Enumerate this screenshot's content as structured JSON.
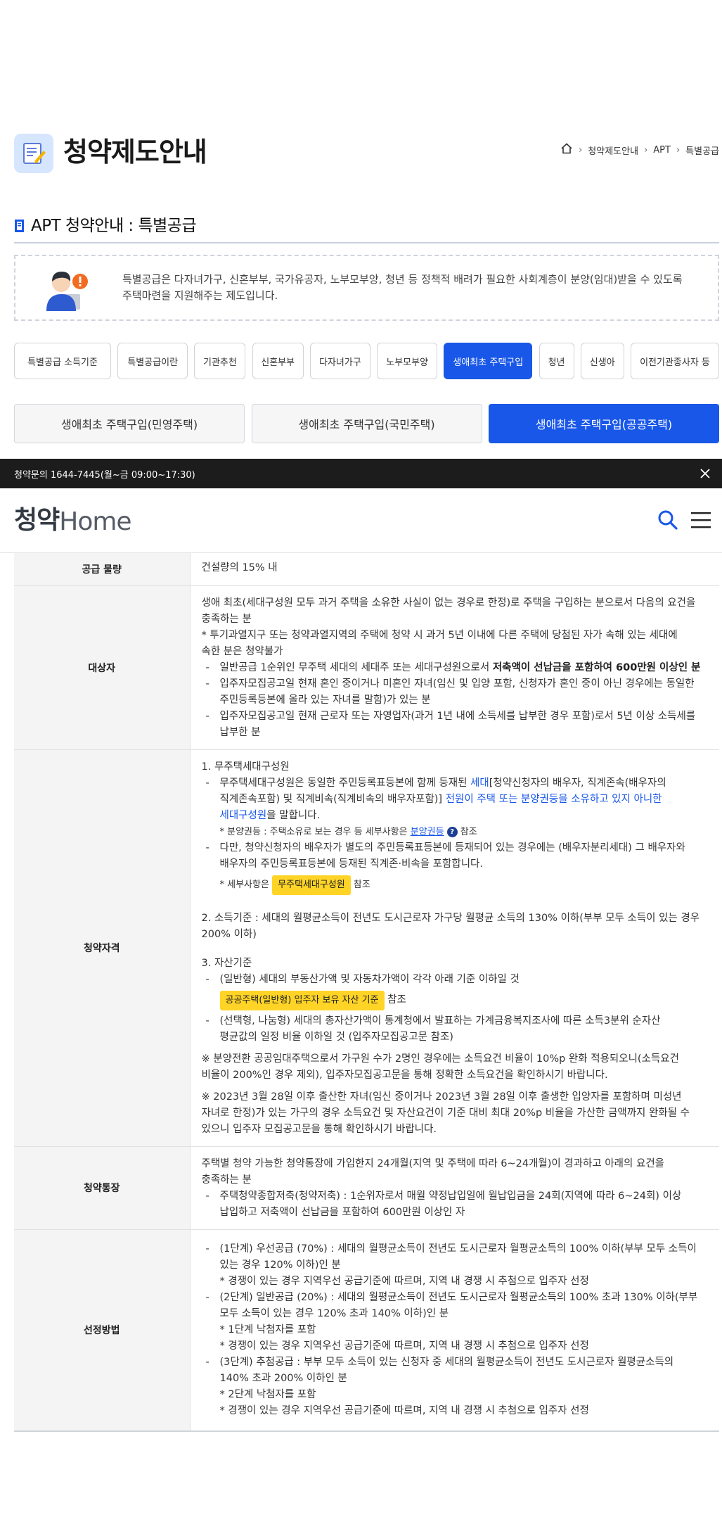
{
  "header": {
    "title": "청약제도안내",
    "breadcrumb": [
      "청약제도안내",
      "APT",
      "특별공급"
    ]
  },
  "section": {
    "title": "APT 청약안내 : 특별공급"
  },
  "notice": {
    "line1": "특별공급은 다자녀가구, 신혼부부, 국가유공자, 노부모부양, 청년 등 정책적 배려가 필요한 사회계층이 분양(임대)받을 수 있도록",
    "line2": "주택마련을 지원해주는 제도입니다."
  },
  "category_tabs": [
    {
      "label": "특별공급 소득기준",
      "active": false
    },
    {
      "label": "특별공급이란",
      "active": false
    },
    {
      "label": "기관추천",
      "active": false
    },
    {
      "label": "신혼부부",
      "active": false
    },
    {
      "label": "다자녀가구",
      "active": false
    },
    {
      "label": "노부모부양",
      "active": false
    },
    {
      "label": "생애최초 주택구입",
      "active": true
    },
    {
      "label": "청년",
      "active": false
    },
    {
      "label": "신생아",
      "active": false
    },
    {
      "label": "이전기관종사자 등",
      "active": false
    }
  ],
  "sub_tabs": [
    {
      "label": "생애최초 주택구입(민영주택)",
      "active": false
    },
    {
      "label": "생애최초 주택구입(국민주택)",
      "active": false
    },
    {
      "label": "생애최초 주택구입(공공주택)",
      "active": true
    }
  ],
  "info_bar": {
    "text": "청약문의 1644-7445(월~금 09:00~17:30)"
  },
  "site": {
    "logo_main": "청약",
    "logo_sub": "Home"
  },
  "table": {
    "supply": {
      "label": "공급 물량",
      "value": "건설량의 15% 내"
    },
    "target": {
      "label": "대상자",
      "p1a": "생애 최초(세대구성원 모두 과거 주택을 소유한 사실이 없는 경우로 한정)로 주택을 구입하는 분으로서 다음의 요건을",
      "p1b": "충족하는 분",
      "p2a": "* 투기과열지구 또는 청약과열지역의 주택에 청약 시 과거 5년 이내에 다른 주택에 당첨된 자가 속해 있는 세대에",
      "p2b": "속한 분은 청약불가",
      "d1_pre": "일반공급 1순위인 무주택 세대의 세대주 또는 세대구성원으로서 ",
      "d1_bold": "저축액이 선납금을 포함하여 600만원 이상인 분",
      "d2a": "입주자모집공고일 현재 혼인 중이거나 미혼인 자녀(임신 및 입양 포함, 신청자가 혼인 중이 아닌 경우에는 동일한",
      "d2b": "주민등록등본에 올라 있는 자녀를 말함)가 있는 분",
      "d3a": "입주자모집공고일 현재 근로자 또는 자영업자(과거 1년 내에 소득세를 납부한 경우 포함)로서 5년 이상 소득세를",
      "d3b": "납부한 분"
    },
    "qual": {
      "label": "청약자격",
      "h1": "1. 무주택세대구성원",
      "d1a_pre": "무주택세대구성원은 동일한 주민등록표등본에 함께 등재된 ",
      "d1a_blue": "세대",
      "d1a_post": "[청약신청자의 배우자, 직계존속(배우자의",
      "d1b_pre": "직계존속포함) 및 직계비속(직계비속의 배우자포함)] ",
      "d1b_blue": "전원이 주택 또는 분양권등을 소유하고 있지 아니한",
      "d1c_blue": "세대구성원",
      "d1c_post": "을 말합니다.",
      "note1_pre": "* 분양권등 : 주택소유로 보는 경우 등 세부사항은 ",
      "note1_link": "분양권등",
      "note1_q": "?",
      "note1_post": " 참조",
      "d2a": "다만, 청약신청자의 배우자가 별도의 주민등록표등본에 등재되어 있는 경우에는 (배우자분리세대) 그 배우자와",
      "d2b": "배우자의 주민등록표등본에 등재된 직계존·비속을 포함합니다.",
      "note2_pre": "* 세부사항은 ",
      "note2_btn": "무주택세대구성원",
      "note2_post": " 참조",
      "h2a": "2. 소득기준 : 세대의 월평균소득이 전년도 도시근로자 가구당 월평균 소득의 130% 이하(부부 모두 소득이 있는 경우",
      "h2b": "200% 이하)",
      "h3": "3. 자산기준",
      "d3": "(일반형) 세대의 부동산가액 및 자동차가액이 각각 아래 기준 이하일 것",
      "d3_btn": "공공주택(일반형) 입주자 보유 자산 기준",
      "d3_post": " 참조",
      "d4a": "(선택형, 나눔형) 세대의 총자산가액이 통계청에서 발표하는 가계금융복지조사에 따른 소득3분위 순자산",
      "d4b": "평균값의 일정 비율 이하일 것 (입주자모집공고문 참조)",
      "n1a": "※ 분양전환 공공임대주택으로서 가구원 수가 2명인 경우에는 소득요건 비율이 10%p 완화 적용되오니(소득요건",
      "n1b": "비율이 200%인 경우 제외), 입주자모집공고문을 통해 정확한 소득요건을 확인하시기 바랍니다.",
      "n2a": "※ 2023년 3월 28일 이후 출산한 자녀(임신 중이거나 2023년 3월 28일 이후 출생한 입양자를 포함하며 미성년",
      "n2b": "자녀로 한정)가 있는 가구의 경우 소득요건 및 자산요건이 기준 대비 최대 20%p 비율을 가산한 금액까지 완화될 수",
      "n2c": "있으니 입주자 모집공고문을 통해 확인하시기 바랍니다."
    },
    "account": {
      "label": "청약통장",
      "p1a": "주택별 청약 가능한 청약통장에 가입한지 24개월(지역 및 주택에 따라 6~24개월)이 경과하고 아래의 요건을",
      "p1b": "충족하는 분",
      "d1a": "주택청약종합저축(청약저축) : 1순위자로서 매월 약정납입일에 월납입금을 24회(지역에 따라 6~24회) 이상",
      "d1b": "납입하고 저축액이 선납금을 포함하여 600만원 이상인 자"
    },
    "method": {
      "label": "선정방법",
      "s1a": "(1단계) 우선공급 (70%) : 세대의 월평균소득이 전년도 도시근로자 월평균소득의 100% 이하(부부 모두 소득이",
      "s1b": "있는 경우 120% 이하)인 분",
      "s1c": "* 경쟁이 있는 경우 지역우선 공급기준에 따르며, 지역 내 경쟁 시 추첨으로 입주자 선정",
      "s2a": "(2단계) 일반공급 (20%) : 세대의 월평균소득이 전년도 도시근로자 월평균소득의 100% 초과 130% 이하(부부",
      "s2b": "모두 소득이 있는 경우 120% 초과 140% 이하)인 분",
      "s2c": "* 1단계 낙첨자를 포함",
      "s2d": "* 경쟁이 있는 경우 지역우선 공급기준에 따르며, 지역 내 경쟁 시 추첨으로 입주자 선정",
      "s3a": "(3단계) 추첨공급 : 부부 모두 소득이 있는 신청자 중 세대의 월평균소득이 전년도 도시근로자 월평균소득의",
      "s3b": "140% 초과 200% 이하인 분",
      "s3c": "* 2단계 낙첨자를 포함",
      "s3d": "* 경쟁이 있는 경우 지역우선 공급기준에 따르며, 지역 내 경쟁 시 추첨으로 입주자 선정"
    }
  },
  "colors": {
    "accent": "#1957e8",
    "highlight": "#ffd426",
    "bar": "#1c1c1c"
  },
  "icons": [
    "home-icon",
    "chevron-right-icon",
    "close-icon",
    "search-icon",
    "menu-icon",
    "document-icon"
  ]
}
